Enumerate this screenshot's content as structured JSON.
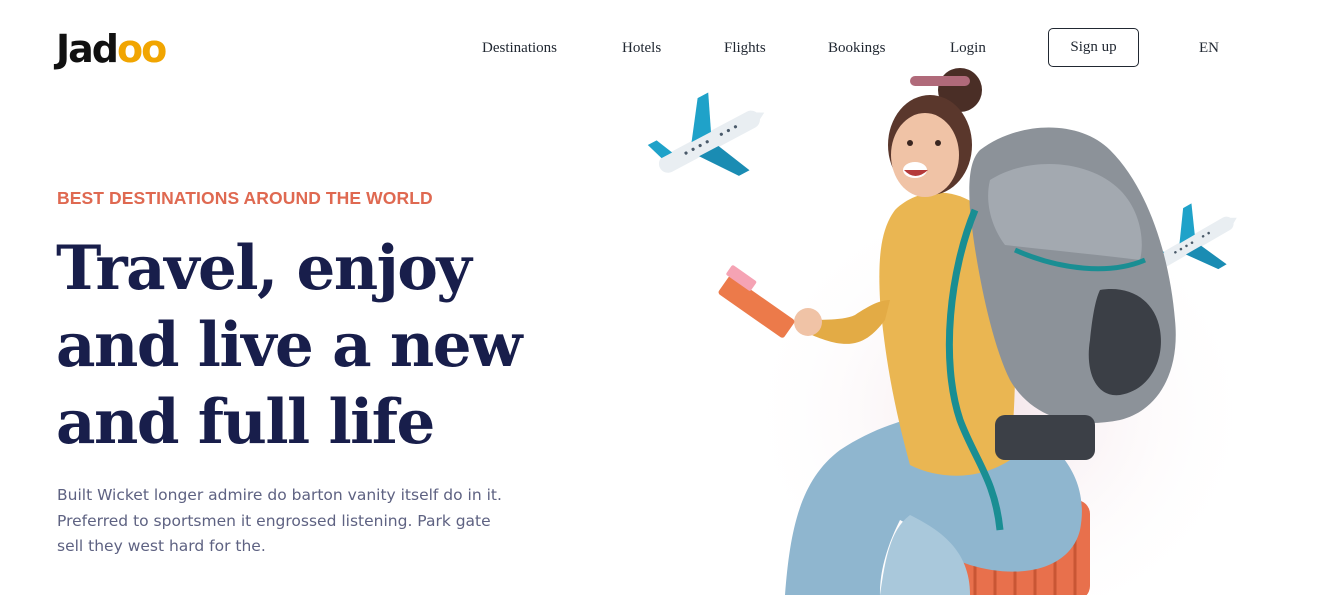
{
  "logo": {
    "text_main": "Jad",
    "text_accent": "oo"
  },
  "nav": {
    "items": [
      "Destinations",
      "Hotels",
      "Flights",
      "Bookings",
      "Login"
    ],
    "signup_label": "Sign up",
    "language": "EN"
  },
  "hero": {
    "eyebrow": "BEST DESTINATIONS AROUND THE WORLD",
    "headline_lines": [
      "Travel, enjoy",
      "and live a new",
      "and full life"
    ],
    "description_lines": [
      "Built Wicket longer admire do barton vanity itself do in it.",
      "Preferred to sportsmen it engrossed listening. Park gate",
      "sell they west hard for the."
    ]
  },
  "colors": {
    "accent": "#df6951",
    "heading": "#181e4b",
    "body_text": "#5e6282",
    "logo_accent": "#f1a501"
  },
  "icons": [
    "airplane-icon",
    "airplane-icon"
  ]
}
